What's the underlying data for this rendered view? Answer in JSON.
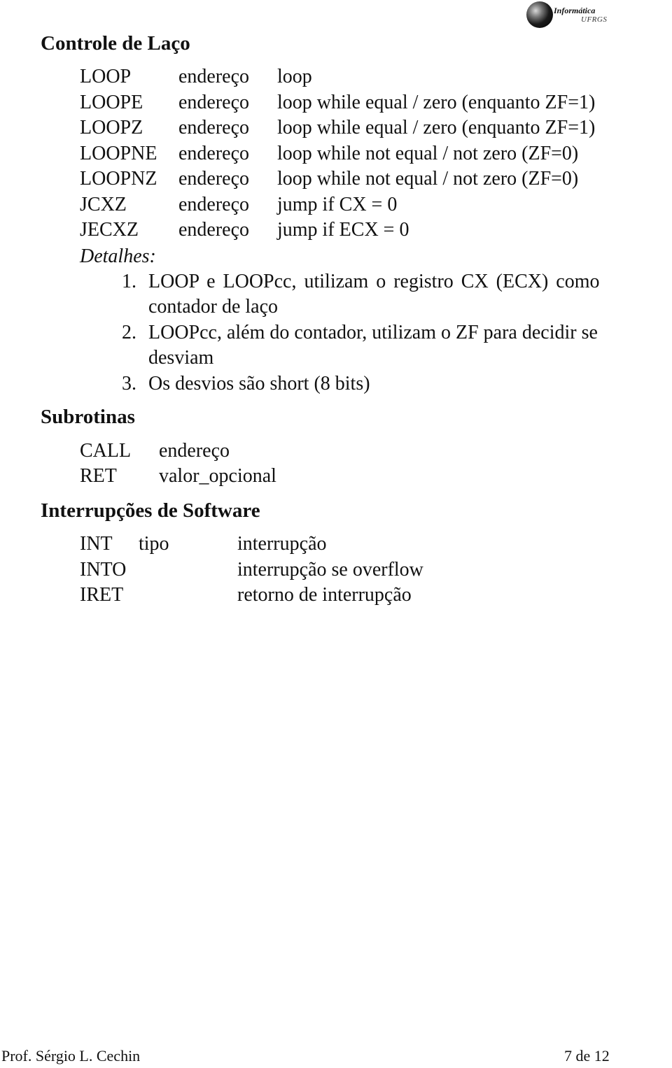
{
  "logo": {
    "line1": "Informática",
    "line2": "UFRGS"
  },
  "sections": {
    "loop_control": {
      "title": "Controle de Laço",
      "rows": [
        {
          "mnemonic": "LOOP",
          "operand": "endereço",
          "description": "loop"
        },
        {
          "mnemonic": "LOOPE",
          "operand": "endereço",
          "description": "loop while equal / zero (enquanto ZF=1)"
        },
        {
          "mnemonic": "LOOPZ",
          "operand": "endereço",
          "description": "loop while equal / zero (enquanto ZF=1)"
        },
        {
          "mnemonic": "LOOPNE",
          "operand": "endereço",
          "description": "loop while not equal / not zero (ZF=0)"
        },
        {
          "mnemonic": "LOOPNZ",
          "operand": "endereço",
          "description": "loop while not equal / not zero (ZF=0)"
        },
        {
          "mnemonic": "JCXZ",
          "operand": "endereço",
          "description": "jump if CX = 0"
        },
        {
          "mnemonic": "JECXZ",
          "operand": "endereço",
          "description": "jump if ECX = 0"
        }
      ],
      "details_label": "Detalhes:",
      "details": [
        {
          "num": "1.",
          "lines": [
            "LOOP e LOOPcc, utilizam o registro CX (ECX) como",
            "contador de laço"
          ]
        },
        {
          "num": "2.",
          "lines": [
            "LOOPcc, além do contador, utilizam o ZF para decidir se",
            "desviam"
          ]
        },
        {
          "num": "3.",
          "lines": [
            "Os desvios são short (8 bits)"
          ]
        }
      ]
    },
    "subroutines": {
      "title": "Subrotinas",
      "rows": [
        {
          "mnemonic": "CALL",
          "operand": "endereço"
        },
        {
          "mnemonic": "RET",
          "operand": "valor_opcional"
        }
      ]
    },
    "software_interrupts": {
      "title": "Interrupções de Software",
      "rows": [
        {
          "mnemonic": "INT",
          "operand": "tipo",
          "description": "interrupção"
        },
        {
          "mnemonic": "INTO",
          "operand": "",
          "description": "interrupção se overflow"
        },
        {
          "mnemonic": "IRET",
          "operand": "",
          "description": "retorno de interrupção"
        }
      ]
    }
  },
  "footer": {
    "author": "Prof. Sérgio L. Cechin",
    "page": "7 de 12"
  }
}
